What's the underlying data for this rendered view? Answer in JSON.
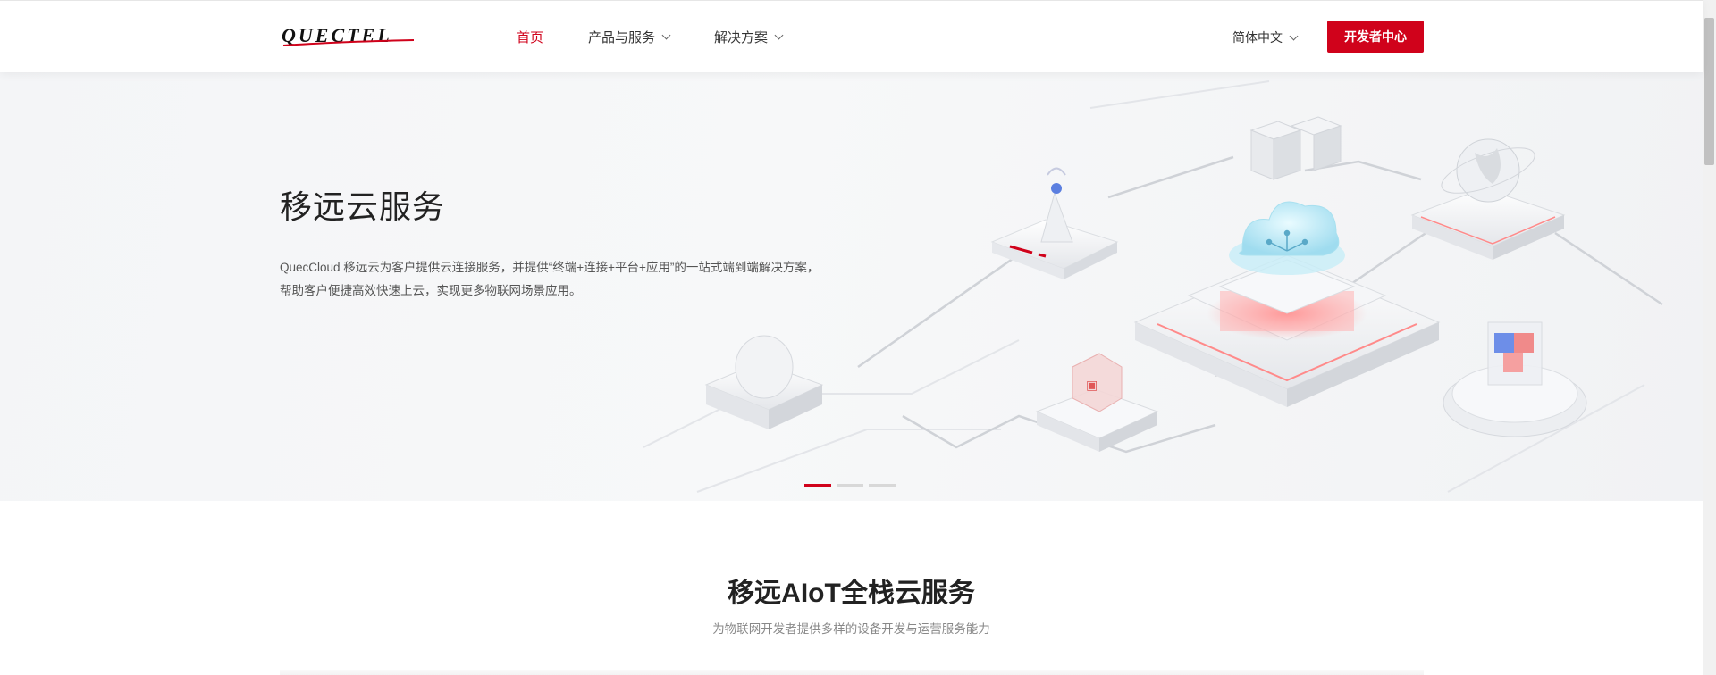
{
  "header": {
    "logo_text": "QUECTEL",
    "nav": [
      {
        "label": "首页",
        "active": true,
        "has_dropdown": false
      },
      {
        "label": "产品与服务",
        "active": false,
        "has_dropdown": true
      },
      {
        "label": "解决方案",
        "active": false,
        "has_dropdown": true
      }
    ],
    "language": "简体中文",
    "developer_button": "开发者中心"
  },
  "hero": {
    "title": "移远云服务",
    "description": "QuecCloud 移远云为客户提供云连接服务，并提供“终端+连接+平台+应用”的一站式端到端解决方案，帮助客户便捷高效快速上云，实现更多物联网场景应用。",
    "slides": 3,
    "active_slide": 0
  },
  "section": {
    "title": "移远AIoT全栈云服务",
    "subtitle": "为物联网开发者提供多样的设备开发与运营服务能力"
  },
  "colors": {
    "accent": "#d0021b",
    "text": "#333333",
    "muted": "#888888"
  }
}
